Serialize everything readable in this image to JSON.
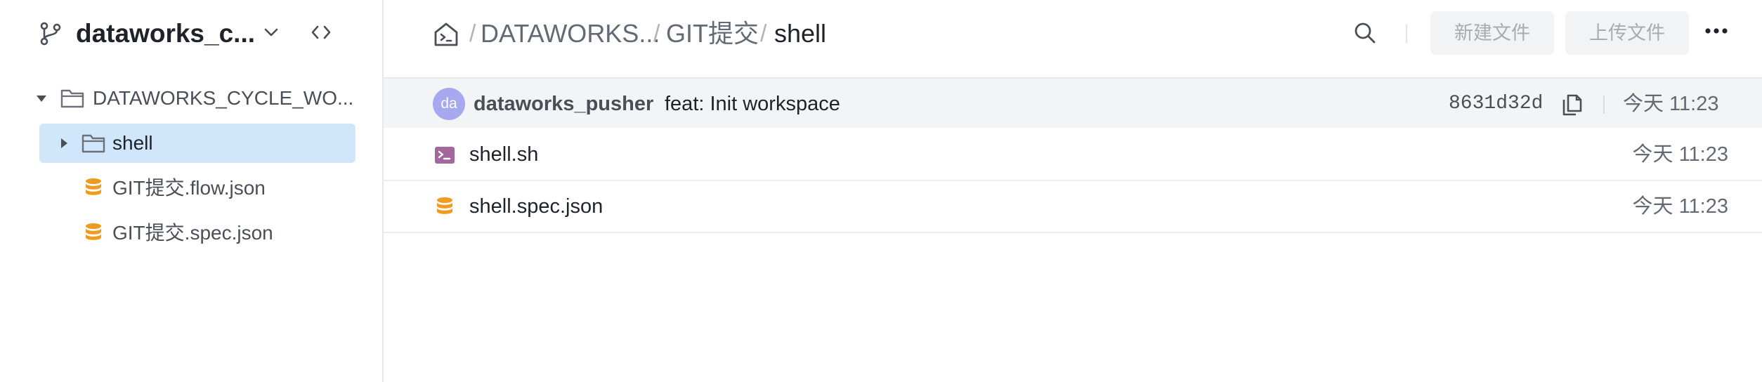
{
  "sidebar": {
    "repo_name": "dataworks_c...",
    "tree": [
      {
        "label": "DATAWORKS_CYCLE_WO...",
        "type": "folder",
        "expanded": true
      },
      {
        "label": "shell",
        "type": "folder",
        "expanded": false,
        "selected": true
      },
      {
        "label": "GIT提交.flow.json",
        "type": "json-file"
      },
      {
        "label": "GIT提交.spec.json",
        "type": "json-file"
      }
    ]
  },
  "header": {
    "breadcrumb": [
      "DATAWORKS...",
      "GIT提交",
      "shell"
    ],
    "separator": "/",
    "new_file_label": "新建文件",
    "upload_file_label": "上传文件"
  },
  "commit": {
    "avatar_text": "da",
    "author": "dataworks_pusher",
    "message": "feat: Init workspace",
    "hash": "8631d32d",
    "time": "今天 11:23"
  },
  "files": [
    {
      "name": "shell.sh",
      "icon": "terminal-icon",
      "time": "今天 11:23"
    },
    {
      "name": "shell.spec.json",
      "icon": "json-file-icon",
      "time": "今天 11:23"
    }
  ],
  "colors": {
    "selected_bg": "#cfe6fb",
    "json_icon": "#f09a1f",
    "terminal_icon": "#a3679e",
    "avatar": "#a6a8f0"
  }
}
